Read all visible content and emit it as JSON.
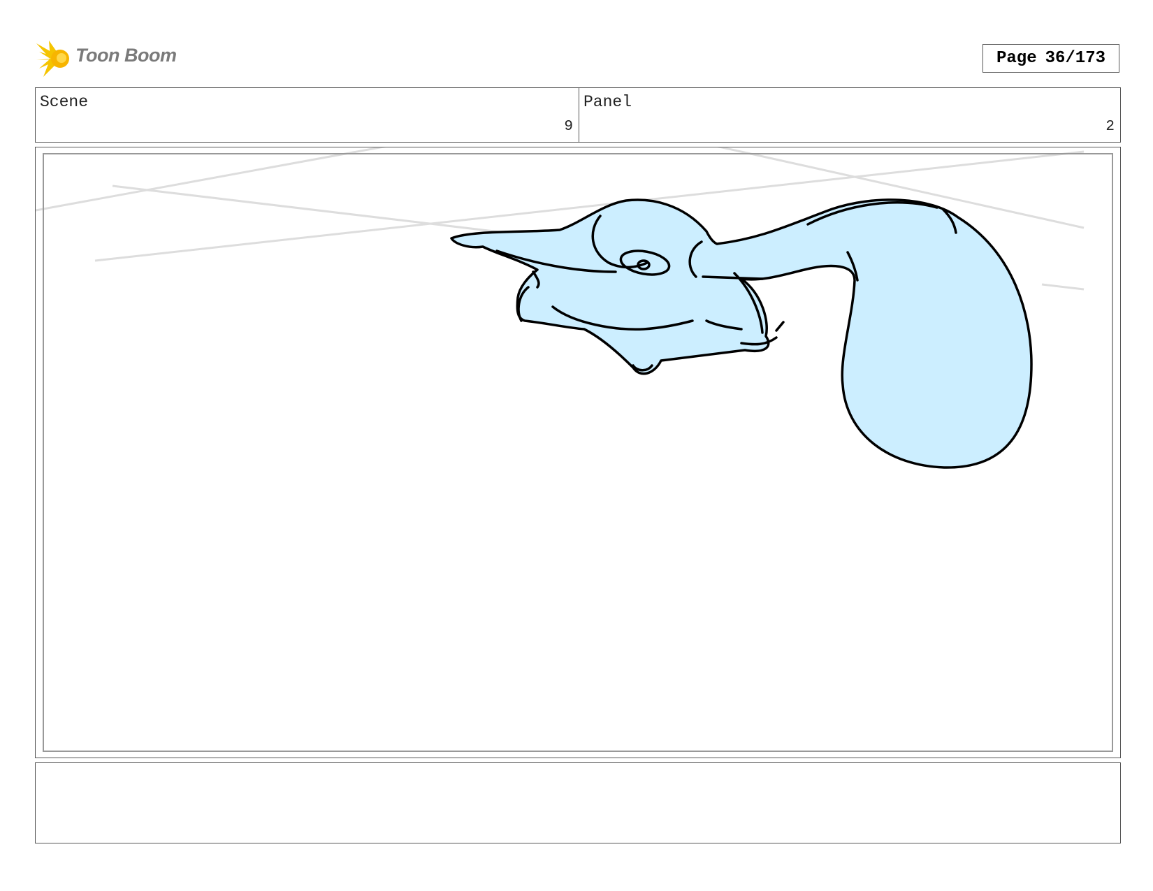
{
  "branding": {
    "logo_text": "Toon Boom",
    "logo_accent": "#f5c400"
  },
  "page_indicator": {
    "label": "Page",
    "value": "36/173"
  },
  "header": {
    "scene_label": "Scene",
    "scene_value": "9",
    "panel_label": "Panel",
    "panel_value": "2"
  },
  "drawing": {
    "fill_color": "#cceeff",
    "stroke_color": "#000000",
    "guide_color": "#dddddd"
  },
  "notes": {
    "text": ""
  }
}
